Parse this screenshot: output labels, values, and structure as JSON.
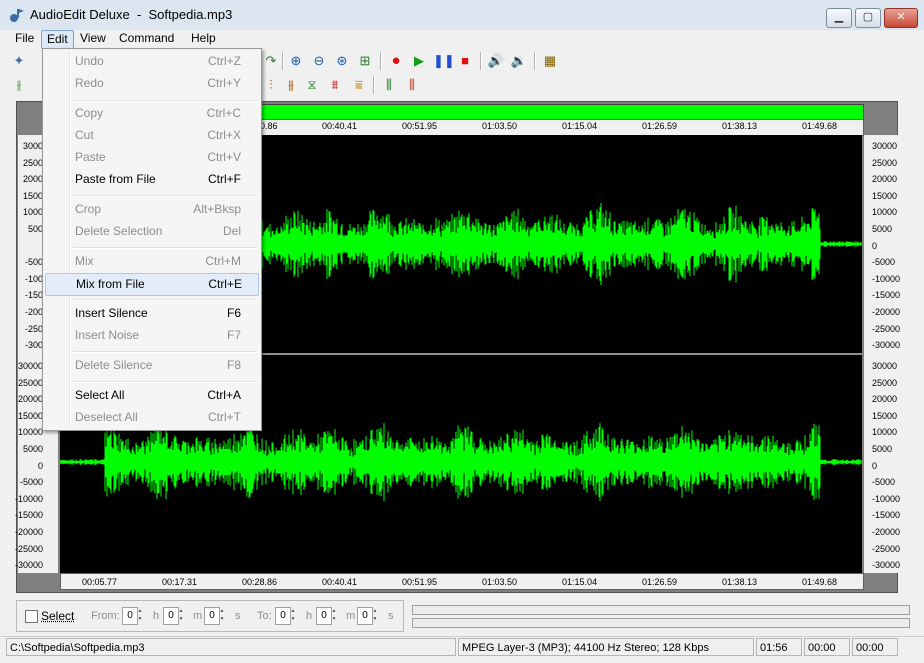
{
  "window": {
    "title": "AudioEdit Deluxe  -  Softpedia.mp3",
    "minimize": "▁",
    "maximize": "▢",
    "close": "✕"
  },
  "menubar": {
    "items": [
      "File",
      "Edit",
      "View",
      "Command",
      "Help"
    ]
  },
  "edit_menu": {
    "items": [
      {
        "label": "Undo",
        "shortcut": "Ctrl+Z",
        "enabled": false
      },
      {
        "label": "Redo",
        "shortcut": "Ctrl+Y",
        "enabled": false
      },
      {
        "label": "Copy",
        "shortcut": "Ctrl+C",
        "enabled": false
      },
      {
        "label": "Cut",
        "shortcut": "Ctrl+X",
        "enabled": false
      },
      {
        "label": "Paste",
        "shortcut": "Ctrl+V",
        "enabled": false
      },
      {
        "label": "Paste from File",
        "shortcut": "Ctrl+F",
        "enabled": true
      },
      {
        "label": "Crop",
        "shortcut": "Alt+Bksp",
        "enabled": false
      },
      {
        "label": "Delete Selection",
        "shortcut": "Del",
        "enabled": false
      },
      {
        "label": "Mix",
        "shortcut": "Ctrl+M",
        "enabled": false
      },
      {
        "label": "Mix from File",
        "shortcut": "Ctrl+E",
        "enabled": true,
        "highlighted": true
      },
      {
        "label": "Insert Silence",
        "shortcut": "F6",
        "enabled": true
      },
      {
        "label": "Insert Noise",
        "shortcut": "F7",
        "enabled": false
      },
      {
        "label": "Delete Silence",
        "shortcut": "F8",
        "enabled": false
      },
      {
        "label": "Select All",
        "shortcut": "Ctrl+A",
        "enabled": true
      },
      {
        "label": "Deselect All",
        "shortcut": "Ctrl+T",
        "enabled": false
      }
    ]
  },
  "timeline": {
    "top_labels": [
      "0.86",
      "00:40.41",
      "00:51.95",
      "01:03.50",
      "01:15.04",
      "01:26.59",
      "01:38.13",
      "01:49.68"
    ],
    "bottom_labels": [
      "00:05.77",
      "00:17.31",
      "00:28.86",
      "00:40.41",
      "00:51.95",
      "01:03.50",
      "01:15.04",
      "01:26.59",
      "01:38.13",
      "01:49.68"
    ]
  },
  "amplitude_labels": [
    "30000",
    "25000",
    "20000",
    "15000",
    "10000",
    "5000",
    "0",
    "-5000",
    "-10000",
    "-15000",
    "-20000",
    "-25000",
    "-30000"
  ],
  "left_axis_top_partial": [
    "3000",
    "2500",
    "2000",
    "1500",
    "1000",
    "500",
    "",
    "-500",
    "-100",
    "-150",
    "-200",
    "-250",
    "-300"
  ],
  "waveform_color": "#00ff00",
  "selection_panel": {
    "select_label": "Select",
    "from_label": "From:",
    "to_label": "To:",
    "h": "h",
    "m": "m",
    "s": "s",
    "zero": "0"
  },
  "statusbar": {
    "path": "C:\\Softpedia\\Softpedia.mp3",
    "format": "MPEG Layer-3 (MP3); 44100 Hz Stereo; 128 Kbps",
    "length": "01:56",
    "pos1": "00:00",
    "pos2": "00:00"
  },
  "toolbar_icons": [
    "new-icon",
    "zoom-in-icon",
    "zoom-out-icon",
    "zoom-selection-icon",
    "zoom-fit-icon",
    "record-icon",
    "play-icon",
    "pause-icon",
    "stop-icon",
    "volume-icon",
    "volume-settings-icon",
    "effects-icon"
  ]
}
